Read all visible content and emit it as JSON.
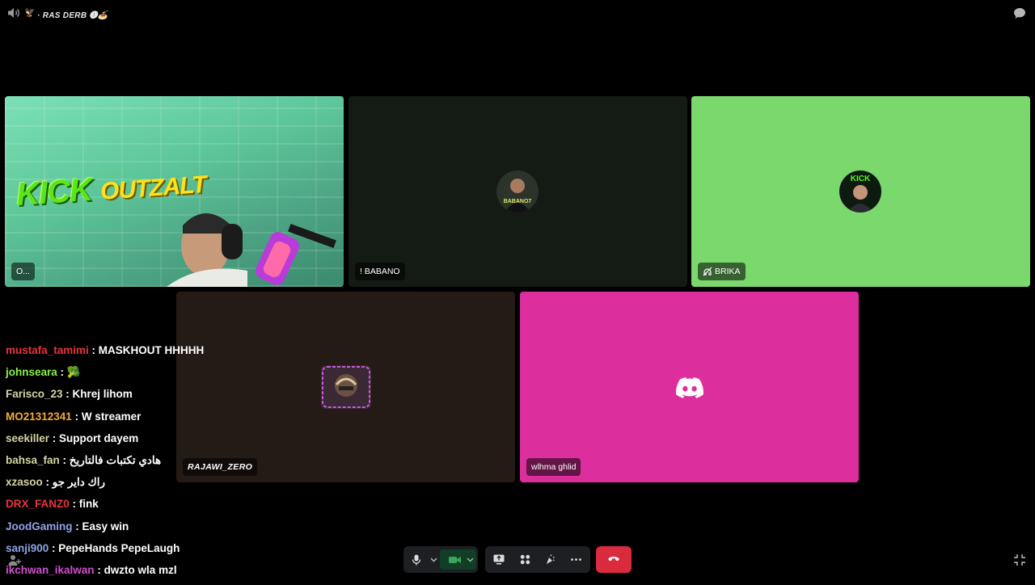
{
  "channel": {
    "emoji": "🦅",
    "name": "· RAS DERB 🅘🍝"
  },
  "tiles": {
    "outzalt": {
      "label": "O...",
      "overlay_title": "KICK",
      "overlay_sub": "OUTZALT"
    },
    "babano": {
      "label": "! BABANO"
    },
    "brika": {
      "label": "BRIKA"
    },
    "rajawi": {
      "label": "RAJAWI_ZERO"
    },
    "wlhma": {
      "label": "wlhma ghlid"
    }
  },
  "chat": [
    {
      "user": "mustafa_tamimi",
      "color": "#e8333b",
      "text": "MASKHOUT HHHHH"
    },
    {
      "user": "johnseara",
      "color": "#8af24a",
      "text": "🥦"
    },
    {
      "user": "Farisco_23",
      "color": "#d6d3a5",
      "text": "Khrej lihom"
    },
    {
      "user": "MO21312341",
      "color": "#f2a93b",
      "text": "W streamer"
    },
    {
      "user": "seekiller",
      "color": "#d6d3a5",
      "text": "Support dayem"
    },
    {
      "user": "bahsa_fan",
      "color": "#d6d3a5",
      "text": "هادي تكتبات فالتاريخ"
    },
    {
      "user": "xzasoo",
      "color": "#d6d3a5",
      "text": "راك داير جو"
    },
    {
      "user": "DRX_FANZ0",
      "color": "#e8333b",
      "text": "fink"
    },
    {
      "user": "JoodGaming",
      "color": "#8fa2e8",
      "text": "Easy win"
    },
    {
      "user": "sanji900",
      "color": "#8fa2e8",
      "text": "PepeHands PepeLaugh"
    },
    {
      "user": "ikchwan_ikalwan",
      "color": "#d14fd1",
      "text": "dwzto wla mzl"
    }
  ],
  "colors": {
    "hangup": "#da2a3e",
    "discord_pink": "#dc2f9d",
    "brika_green": "#7bd86c"
  }
}
